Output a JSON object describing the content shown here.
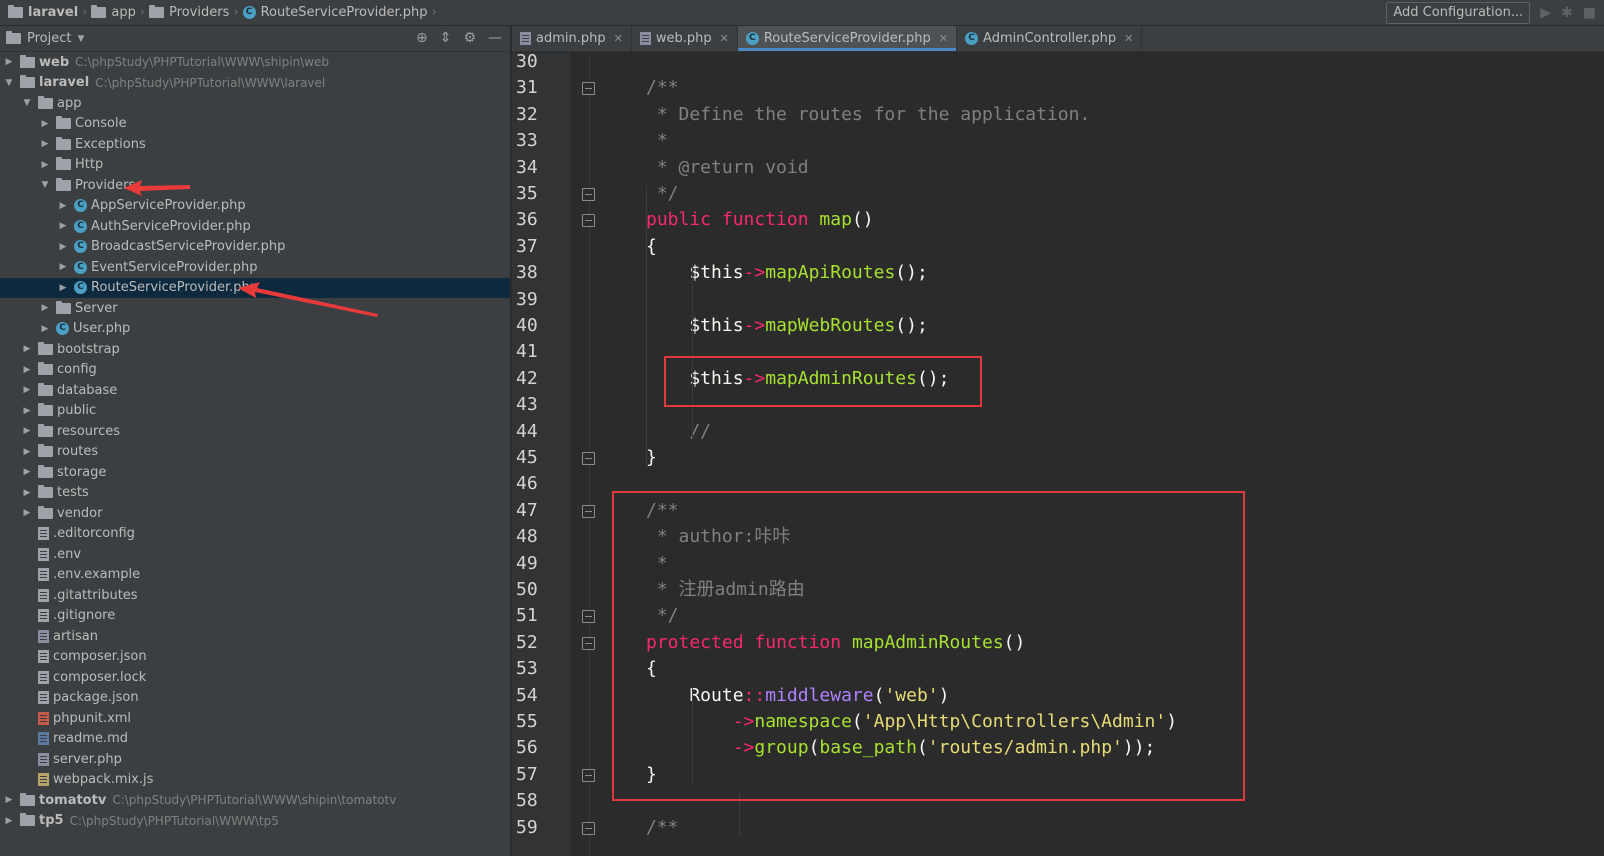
{
  "breadcrumb": [
    {
      "label": "laravel",
      "icon": "folder-icon",
      "bold": true
    },
    {
      "label": "app",
      "icon": "folder-icon"
    },
    {
      "label": "Providers",
      "icon": "folder-icon"
    },
    {
      "label": "RouteServiceProvider.php",
      "icon": "php-class-icon"
    }
  ],
  "toolbar": {
    "add_config_label": "Add Configuration..."
  },
  "project_panel": {
    "title": "Project",
    "tree": [
      {
        "label": "web",
        "path": "C:\\phpStudy\\PHPTutorial\\WWW\\shipin\\web",
        "depth": 0,
        "type": "folder",
        "arrow": "right",
        "bold": true
      },
      {
        "label": "laravel",
        "path": "C:\\phpStudy\\PHPTutorial\\WWW\\laravel",
        "depth": 0,
        "type": "folder",
        "arrow": "down",
        "bold": true
      },
      {
        "label": "app",
        "depth": 1,
        "type": "folder",
        "arrow": "down"
      },
      {
        "label": "Console",
        "depth": 2,
        "type": "folder",
        "arrow": "right"
      },
      {
        "label": "Exceptions",
        "depth": 2,
        "type": "folder",
        "arrow": "right"
      },
      {
        "label": "Http",
        "depth": 2,
        "type": "folder",
        "arrow": "right"
      },
      {
        "label": "Providers",
        "depth": 2,
        "type": "folder",
        "arrow": "down"
      },
      {
        "label": "AppServiceProvider.php",
        "depth": 3,
        "type": "class",
        "arrow": "right"
      },
      {
        "label": "AuthServiceProvider.php",
        "depth": 3,
        "type": "class",
        "arrow": "right"
      },
      {
        "label": "BroadcastServiceProvider.php",
        "depth": 3,
        "type": "class",
        "arrow": "right"
      },
      {
        "label": "EventServiceProvider.php",
        "depth": 3,
        "type": "class",
        "arrow": "right"
      },
      {
        "label": "RouteServiceProvider.php",
        "depth": 3,
        "type": "class",
        "arrow": "right",
        "selected": true
      },
      {
        "label": "Server",
        "depth": 2,
        "type": "folder",
        "arrow": "right"
      },
      {
        "label": "User.php",
        "depth": 2,
        "type": "class",
        "arrow": "right"
      },
      {
        "label": "bootstrap",
        "depth": 1,
        "type": "folder",
        "arrow": "right"
      },
      {
        "label": "config",
        "depth": 1,
        "type": "folder",
        "arrow": "right"
      },
      {
        "label": "database",
        "depth": 1,
        "type": "folder",
        "arrow": "right"
      },
      {
        "label": "public",
        "depth": 1,
        "type": "folder",
        "arrow": "right"
      },
      {
        "label": "resources",
        "depth": 1,
        "type": "folder",
        "arrow": "right"
      },
      {
        "label": "routes",
        "depth": 1,
        "type": "folder",
        "arrow": "right"
      },
      {
        "label": "storage",
        "depth": 1,
        "type": "folder",
        "arrow": "right"
      },
      {
        "label": "tests",
        "depth": 1,
        "type": "folder",
        "arrow": "right"
      },
      {
        "label": "vendor",
        "depth": 1,
        "type": "folder",
        "arrow": "right"
      },
      {
        "label": ".editorconfig",
        "depth": 1,
        "type": "file"
      },
      {
        "label": ".env",
        "depth": 1,
        "type": "file"
      },
      {
        "label": ".env.example",
        "depth": 1,
        "type": "file"
      },
      {
        "label": ".gitattributes",
        "depth": 1,
        "type": "file"
      },
      {
        "label": ".gitignore",
        "depth": 1,
        "type": "file"
      },
      {
        "label": "artisan",
        "depth": 1,
        "type": "file-php"
      },
      {
        "label": "composer.json",
        "depth": 1,
        "type": "file"
      },
      {
        "label": "composer.lock",
        "depth": 1,
        "type": "file"
      },
      {
        "label": "package.json",
        "depth": 1,
        "type": "file"
      },
      {
        "label": "phpunit.xml",
        "depth": 1,
        "type": "file-xml"
      },
      {
        "label": "readme.md",
        "depth": 1,
        "type": "file-md"
      },
      {
        "label": "server.php",
        "depth": 1,
        "type": "file-php"
      },
      {
        "label": "webpack.mix.js",
        "depth": 1,
        "type": "file-js"
      },
      {
        "label": "tomatotv",
        "path": "C:\\phpStudy\\PHPTutorial\\WWW\\shipin\\tomatotv",
        "depth": 0,
        "type": "folder",
        "arrow": "right",
        "bold": true
      },
      {
        "label": "tp5",
        "path": "C:\\phpStudy\\PHPTutorial\\WWW\\tp5",
        "depth": 0,
        "type": "folder",
        "arrow": "right",
        "bold": true
      }
    ]
  },
  "tabs": [
    {
      "label": "admin.php",
      "icon": "php-file-icon",
      "active": false
    },
    {
      "label": "web.php",
      "icon": "php-file-icon",
      "active": false
    },
    {
      "label": "RouteServiceProvider.php",
      "icon": "php-class-icon",
      "active": true
    },
    {
      "label": "AdminController.php",
      "icon": "php-class-icon",
      "active": false
    }
  ],
  "editor": {
    "lines": [
      {
        "n": "30",
        "tokens": []
      },
      {
        "n": "31",
        "fold": true,
        "tokens": [
          [
            "c-com",
            "/**"
          ]
        ]
      },
      {
        "n": "32",
        "tokens": [
          [
            "c-com",
            " * Define the routes for the application."
          ]
        ]
      },
      {
        "n": "33",
        "tokens": [
          [
            "c-com",
            " *"
          ]
        ]
      },
      {
        "n": "34",
        "tokens": [
          [
            "c-com",
            " * @return void"
          ]
        ]
      },
      {
        "n": "35",
        "fold": true,
        "tokens": [
          [
            "c-com",
            " */"
          ]
        ]
      },
      {
        "n": "36",
        "fold": true,
        "tokens": [
          [
            "c-kw",
            "public"
          ],
          [
            "c-punc",
            " "
          ],
          [
            "c-kw",
            "function"
          ],
          [
            "c-punc",
            " "
          ],
          [
            "c-fn",
            "map"
          ],
          [
            "c-punc",
            "()"
          ]
        ]
      },
      {
        "n": "37",
        "tokens": [
          [
            "c-punc",
            "{"
          ]
        ]
      },
      {
        "n": "38",
        "tokens": [
          [
            "c-var",
            "    $this"
          ],
          [
            "c-op",
            "->"
          ],
          [
            "c-fn",
            "mapApiRoutes"
          ],
          [
            "c-punc",
            "();"
          ]
        ]
      },
      {
        "n": "39",
        "tokens": []
      },
      {
        "n": "40",
        "tokens": [
          [
            "c-var",
            "    $this"
          ],
          [
            "c-op",
            "->"
          ],
          [
            "c-fn",
            "mapWebRoutes"
          ],
          [
            "c-punc",
            "();"
          ]
        ]
      },
      {
        "n": "41",
        "tokens": []
      },
      {
        "n": "42",
        "tokens": [
          [
            "c-var",
            "    $this"
          ],
          [
            "c-op",
            "->"
          ],
          [
            "c-fn",
            "mapAdminRoutes"
          ],
          [
            "c-punc",
            "();"
          ]
        ]
      },
      {
        "n": "43",
        "tokens": []
      },
      {
        "n": "44",
        "tokens": [
          [
            "c-com",
            "    //"
          ]
        ]
      },
      {
        "n": "45",
        "fold": true,
        "tokens": [
          [
            "c-punc",
            "}"
          ]
        ]
      },
      {
        "n": "46",
        "tokens": []
      },
      {
        "n": "47",
        "fold": true,
        "tokens": [
          [
            "c-com",
            "/**"
          ]
        ]
      },
      {
        "n": "48",
        "tokens": [
          [
            "c-com",
            " * author:咔咔"
          ]
        ]
      },
      {
        "n": "49",
        "tokens": [
          [
            "c-com",
            " *"
          ]
        ]
      },
      {
        "n": "50",
        "tokens": [
          [
            "c-com",
            " * 注册admin路由"
          ]
        ]
      },
      {
        "n": "51",
        "fold": true,
        "tokens": [
          [
            "c-com",
            " */"
          ]
        ]
      },
      {
        "n": "52",
        "fold": true,
        "tokens": [
          [
            "c-kw",
            "protected"
          ],
          [
            "c-punc",
            " "
          ],
          [
            "c-kw",
            "function"
          ],
          [
            "c-punc",
            " "
          ],
          [
            "c-fn",
            "mapAdminRoutes"
          ],
          [
            "c-punc",
            "()"
          ]
        ]
      },
      {
        "n": "53",
        "tokens": [
          [
            "c-punc",
            "{"
          ]
        ]
      },
      {
        "n": "54",
        "tokens": [
          [
            "c-cls",
            "    Route"
          ],
          [
            "c-op",
            "::"
          ],
          [
            "c-static",
            "middleware"
          ],
          [
            "c-punc",
            "("
          ],
          [
            "c-str",
            "'web'"
          ],
          [
            "c-punc",
            ")"
          ]
        ]
      },
      {
        "n": "55",
        "tokens": [
          [
            "c-op",
            "        ->"
          ],
          [
            "c-fn",
            "namespace"
          ],
          [
            "c-punc",
            "("
          ],
          [
            "c-str",
            "'App\\Http\\Controllers\\Admin'"
          ],
          [
            "c-punc",
            ")"
          ]
        ]
      },
      {
        "n": "56",
        "tokens": [
          [
            "c-op",
            "        ->"
          ],
          [
            "c-fn",
            "group"
          ],
          [
            "c-punc",
            "("
          ],
          [
            "c-fn",
            "base_path"
          ],
          [
            "c-punc",
            "("
          ],
          [
            "c-str",
            "'routes/admin.php'"
          ],
          [
            "c-punc",
            "));"
          ]
        ]
      },
      {
        "n": "57",
        "fold": true,
        "tokens": [
          [
            "c-punc",
            "}"
          ]
        ]
      },
      {
        "n": "58",
        "tokens": []
      },
      {
        "n": "59",
        "fold": true,
        "tokens": [
          [
            "c-com",
            "/**"
          ]
        ]
      }
    ]
  },
  "colors": {
    "highlight_box": "#e0393d",
    "selection": "#0d293e",
    "accent": "#4a88c7"
  }
}
